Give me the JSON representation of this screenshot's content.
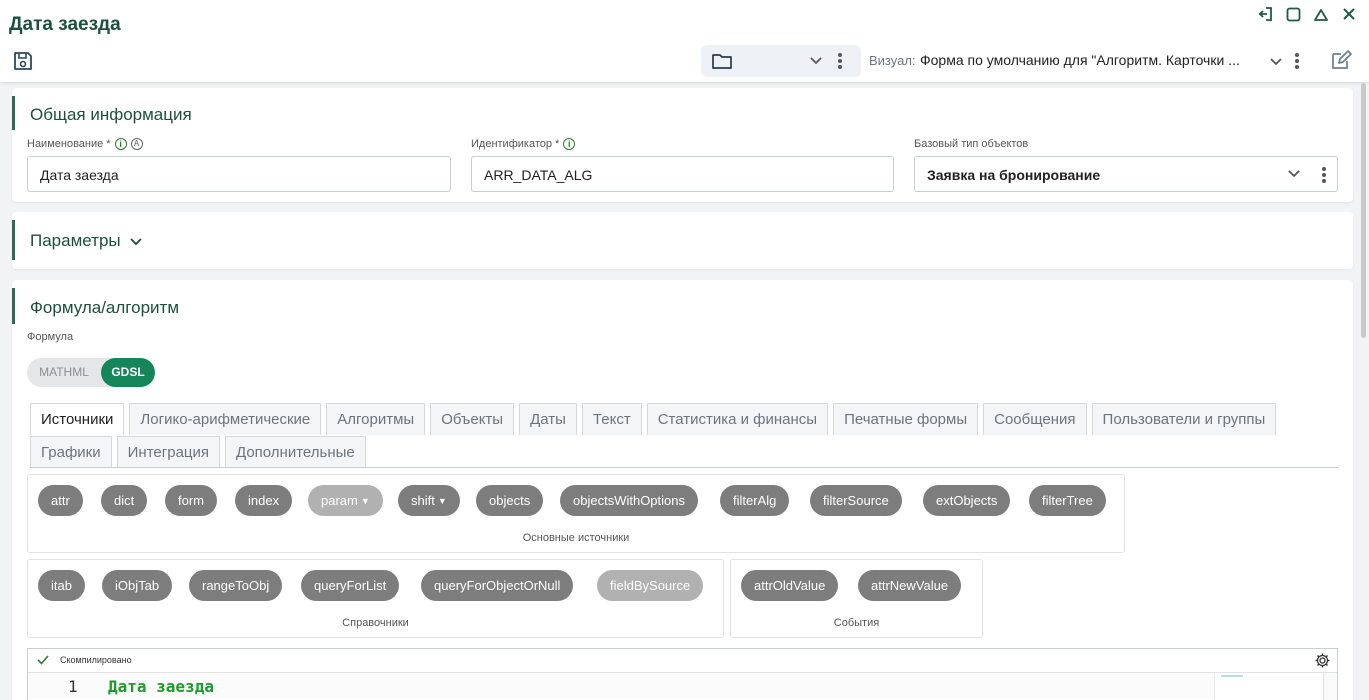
{
  "header": {
    "title": "Дата заезда",
    "visual_label": "Визуал:",
    "visual_value": "Форма по умолчанию для \"Алгоритм. Карточки ..."
  },
  "general": {
    "title": "Общая информация",
    "name_label": "Наименование *",
    "name_value": "Дата заезда",
    "id_label": "Идентификатор *",
    "id_value": "ARR_DATA_ALG",
    "base_type_label": "Базовый тип объектов",
    "base_type_value": "Заявка на бронирование"
  },
  "params": {
    "title": "Параметры"
  },
  "formula": {
    "title": "Формула/алгоритм",
    "label": "Формула",
    "toggle_off": "MATHML",
    "toggle_on": "GDSL"
  },
  "tabs": {
    "row1": [
      "Источники",
      "Логико-арифметические",
      "Алгоритмы",
      "Объекты",
      "Даты",
      "Текст",
      "Статистика и финансы",
      "Печатные формы",
      "Сообщения",
      "Пользователи и группы"
    ],
    "row2": [
      "Графики",
      "Интеграция",
      "Дополнительные"
    ]
  },
  "groups": {
    "main": {
      "caption": "Основные источники",
      "items": [
        "attr",
        "dict",
        "form",
        "index",
        "param",
        "shift",
        "objects",
        "objectsWithOptions",
        "filterAlg",
        "filterSource",
        "extObjects",
        "filterTree"
      ]
    },
    "refs": {
      "caption": "Справочники",
      "items": [
        "itab",
        "iObjTab",
        "rangeToObj",
        "queryForList",
        "queryForObjectOrNull",
        "fieldBySource"
      ]
    },
    "events": {
      "caption": "События",
      "items": [
        "attrOldValue",
        "attrNewValue"
      ]
    }
  },
  "editor": {
    "status": "Скомпилировано",
    "line_no": "1",
    "code": "Дата заезда"
  }
}
